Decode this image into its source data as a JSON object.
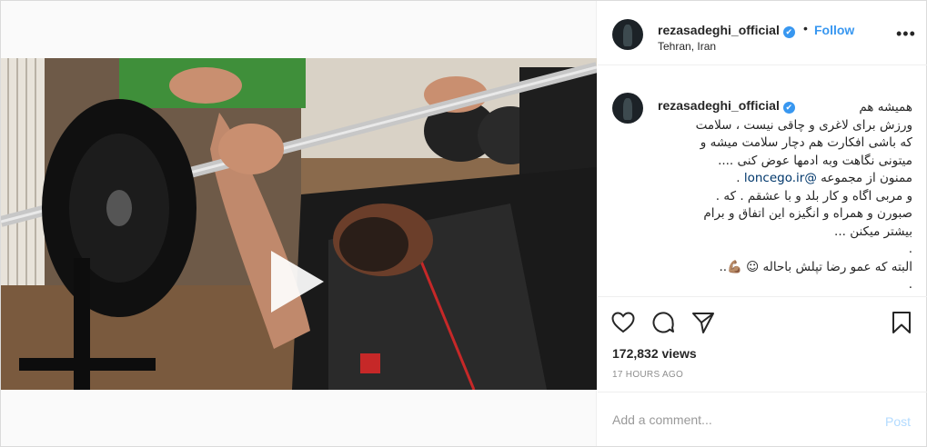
{
  "author": {
    "username": "rezasadeghi_official",
    "verified_badge": "✔",
    "location": "Tehran, Iran",
    "separator": "•",
    "follow_label": "Follow"
  },
  "header": {
    "more_label": "•••"
  },
  "media": {
    "type": "video",
    "play_icon": "play-icon"
  },
  "caption": {
    "username": "rezasadeghi_official",
    "lines": [
      "همیشه هم",
      "ورزش برای لاغری و چاقی نیست ، سلامت",
      "که باشی افکارت هم دچار سلامت میشه و",
      "میتونی نگاهت وبه ادمها عوض کنی ....",
      "ممنون از مجموعه",
      "و مربی اگاه و کار بلد و با عشقم . که .",
      "صبورن و همراه و انگیزه این اتفاق و برام",
      "بیشتر میکنن ...",
      ".",
      "البته که عمو رضا تپلش باحاله ☺ 💪🏽..",
      "."
    ],
    "mention": "@loncego.ir",
    "mention_suffix": " ."
  },
  "actions": {
    "like_icon": "heart-icon",
    "comment_icon": "comment-icon",
    "share_icon": "paper-plane-icon",
    "save_icon": "bookmark-icon"
  },
  "stats": {
    "views": "172,832 views",
    "time_ago": "17 HOURS AGO"
  },
  "comment": {
    "placeholder": "Add a comment...",
    "post_label": "Post"
  },
  "colors": {
    "accent": "#3897f0",
    "mention": "#00376b",
    "post_disabled": "#b3dbff",
    "muted": "#8e8e8e",
    "border": "#dbdbdb"
  }
}
